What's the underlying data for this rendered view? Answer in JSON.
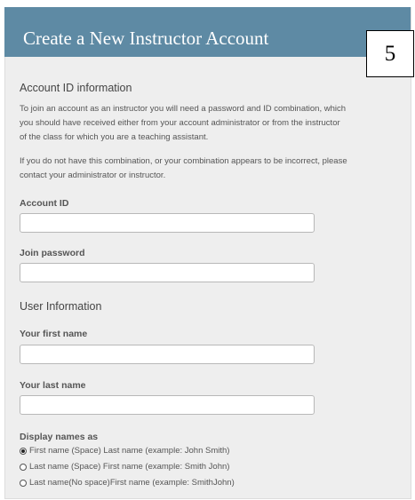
{
  "header": {
    "title": "Create a New Instructor Account"
  },
  "step_badge": "5",
  "account_section": {
    "heading": "Account ID information",
    "intro_lines": [
      "To join an account as an instructor you will need a password and ID combination, which",
      "you should have received either from your account administrator or from the instructor",
      "of the class for which you are a teaching assistant."
    ],
    "help_lines": [
      "If you do not have this combination, or your combination appears to be incorrect, please",
      "contact your administrator or instructor."
    ],
    "account_id": {
      "label": "Account ID",
      "value": ""
    },
    "join_password": {
      "label": "Join password",
      "value": ""
    }
  },
  "user_section": {
    "heading": "User Information",
    "first_name": {
      "label": "Your first name",
      "value": ""
    },
    "last_name": {
      "label": "Your last name",
      "value": ""
    },
    "display_names": {
      "label": "Display names as",
      "options": [
        {
          "label": "First name (Space) Last name (example: John Smith)",
          "selected": true
        },
        {
          "label": "Last name (Space) First name (example: Smith John)",
          "selected": false
        },
        {
          "label": "Last name(No space)First name (example: SmithJohn)",
          "selected": false
        }
      ]
    }
  }
}
